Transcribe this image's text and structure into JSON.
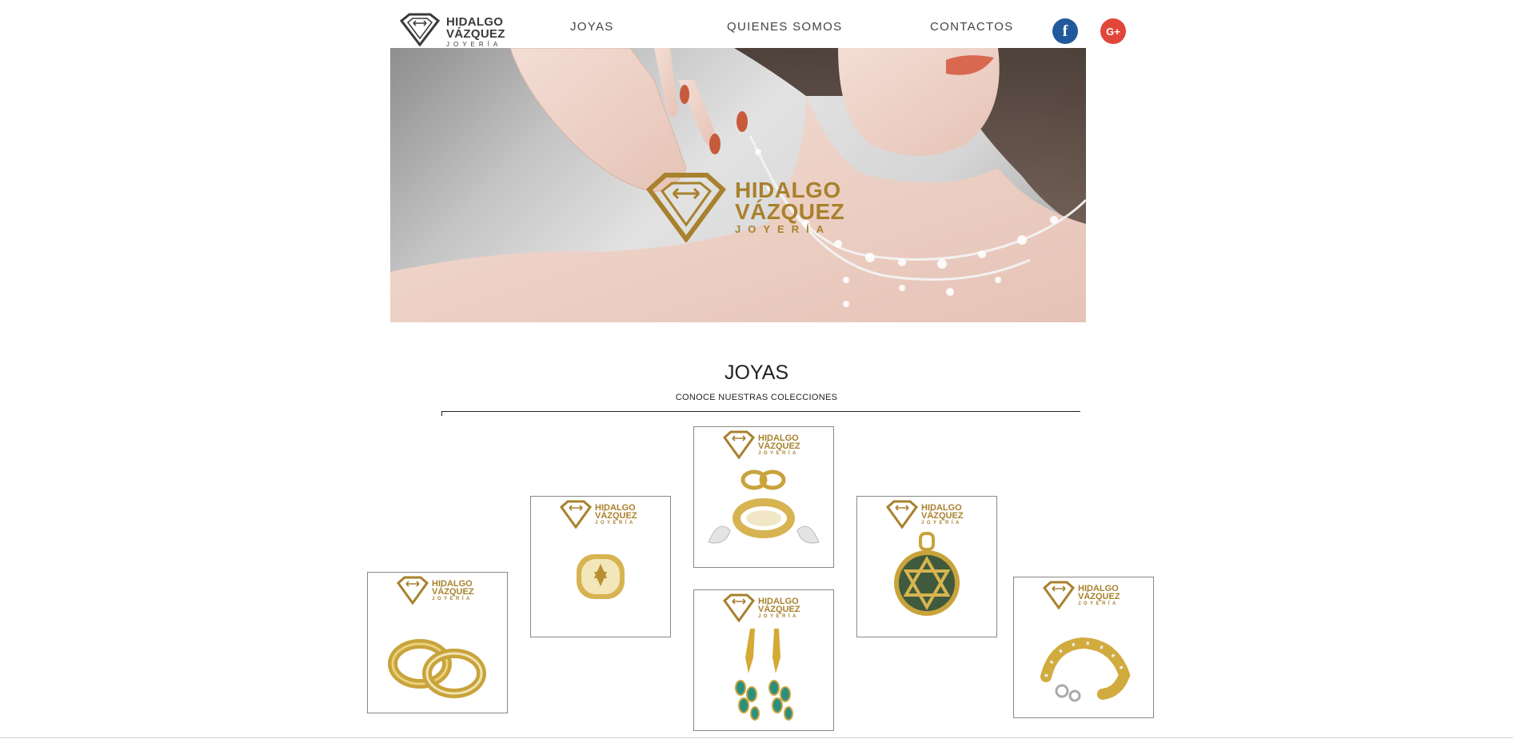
{
  "header": {
    "logo": {
      "line1": "HIDALGO",
      "line2": "VÁZQUEZ",
      "line3": "JOYERÍA"
    },
    "nav": [
      {
        "label": "JOYAS"
      },
      {
        "label": "QUIENES SOMOS"
      },
      {
        "label": "CONTACTOS"
      }
    ],
    "social": {
      "facebook_glyph": "f",
      "googleplus_glyph": "G+"
    }
  },
  "hero": {
    "logo": {
      "line1": "HIDALGO",
      "line2": "VÁZQUEZ",
      "line3": "JOYERÍA"
    }
  },
  "section": {
    "title": "JOYAS",
    "subtitle": "CONOCE NUESTRAS COLECCIONES"
  },
  "products": [
    {
      "logo": {
        "line1": "HIDALGO",
        "line2": "VÁZQUEZ",
        "line3": "JOYERÍA"
      },
      "jewel_icon": "wedding-rings-icon"
    },
    {
      "logo": {
        "line1": "HIDALGO",
        "line2": "VÁZQUEZ",
        "line3": "JOYERÍA"
      },
      "jewel_icon": "wide-ring-icon"
    },
    {
      "logo": {
        "line1": "HIDALGO",
        "line2": "VÁZQUEZ",
        "line3": "JOYERÍA"
      },
      "jewel_icon": "ring-set-icon"
    },
    {
      "logo": {
        "line1": "HIDALGO",
        "line2": "VÁZQUEZ",
        "line3": "JOYERÍA"
      },
      "jewel_icon": "earrings-icon"
    },
    {
      "logo": {
        "line1": "HIDALGO",
        "line2": "VÁZQUEZ",
        "line3": "JOYERÍA"
      },
      "jewel_icon": "star-pendant-icon"
    },
    {
      "logo": {
        "line1": "HIDALGO",
        "line2": "VÁZQUEZ",
        "line3": "JOYERÍA"
      },
      "jewel_icon": "bracelet-icon"
    }
  ],
  "colors": {
    "brand_gold": "#a8812d",
    "facebook_blue": "#215a9c",
    "googleplus_red": "#e0473a",
    "text_dark": "#222222"
  }
}
